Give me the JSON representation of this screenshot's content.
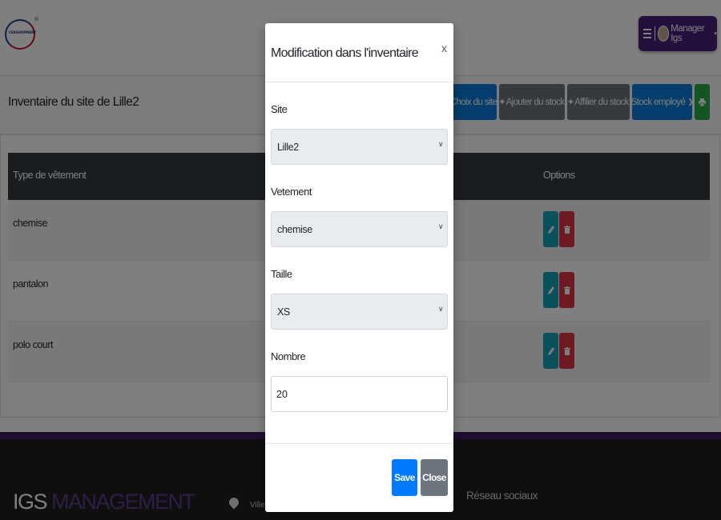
{
  "header": {
    "logo_text": "CERSHOPMENT",
    "logo_registered": "®",
    "user_name": "Manager Igs",
    "user_caret": "▾"
  },
  "page": {
    "title": "Inventaire du site de Lille2",
    "actions": [
      {
        "label": "Choix du site",
        "icon": "",
        "color": "#0d7bd8"
      },
      {
        "label": "Ajouter du stock",
        "icon": "✚",
        "color": "#6c757d"
      },
      {
        "label": "Affilier du stock",
        "icon": "✚",
        "color": "#6c757d"
      },
      {
        "label": "Stock employé",
        "icon": "❯",
        "color": "#0d7bd8"
      },
      {
        "label": "",
        "icon": "print-icon",
        "color": "#28a745"
      }
    ]
  },
  "table": {
    "headers": [
      "Type de vêtement",
      "Options"
    ],
    "rows": [
      {
        "type": "chemise"
      },
      {
        "type": "pantalon"
      },
      {
        "type": "polo court"
      }
    ],
    "icons": {
      "edit": "pencil-icon",
      "delete": "trash-icon"
    }
  },
  "footer": {
    "brand_part1": "IGS",
    "brand_part2": "MANAGEMENT",
    "ville_label": "Ville",
    "social_heading": "Réseau sociaux"
  },
  "modal": {
    "title": "Modification dans l'inventaire",
    "close_symbol": "x",
    "fields": {
      "site": {
        "label": "Site",
        "value": "Lille2"
      },
      "vetement": {
        "label": "Vetement",
        "value": "chemise"
      },
      "taille": {
        "label": "Taille",
        "value": "XS"
      },
      "nombre": {
        "label": "Nombre",
        "value": "20"
      }
    },
    "save_label": "Save",
    "close_label": "Close"
  },
  "colors": {
    "header_purple": "#4a1f7a",
    "primary": "#007bff",
    "secondary": "#6c757d",
    "success": "#28a745",
    "info": "#17a2b8",
    "danger": "#dc3545",
    "table_head": "#343a40",
    "footer_bg": "#1e1e1e"
  }
}
